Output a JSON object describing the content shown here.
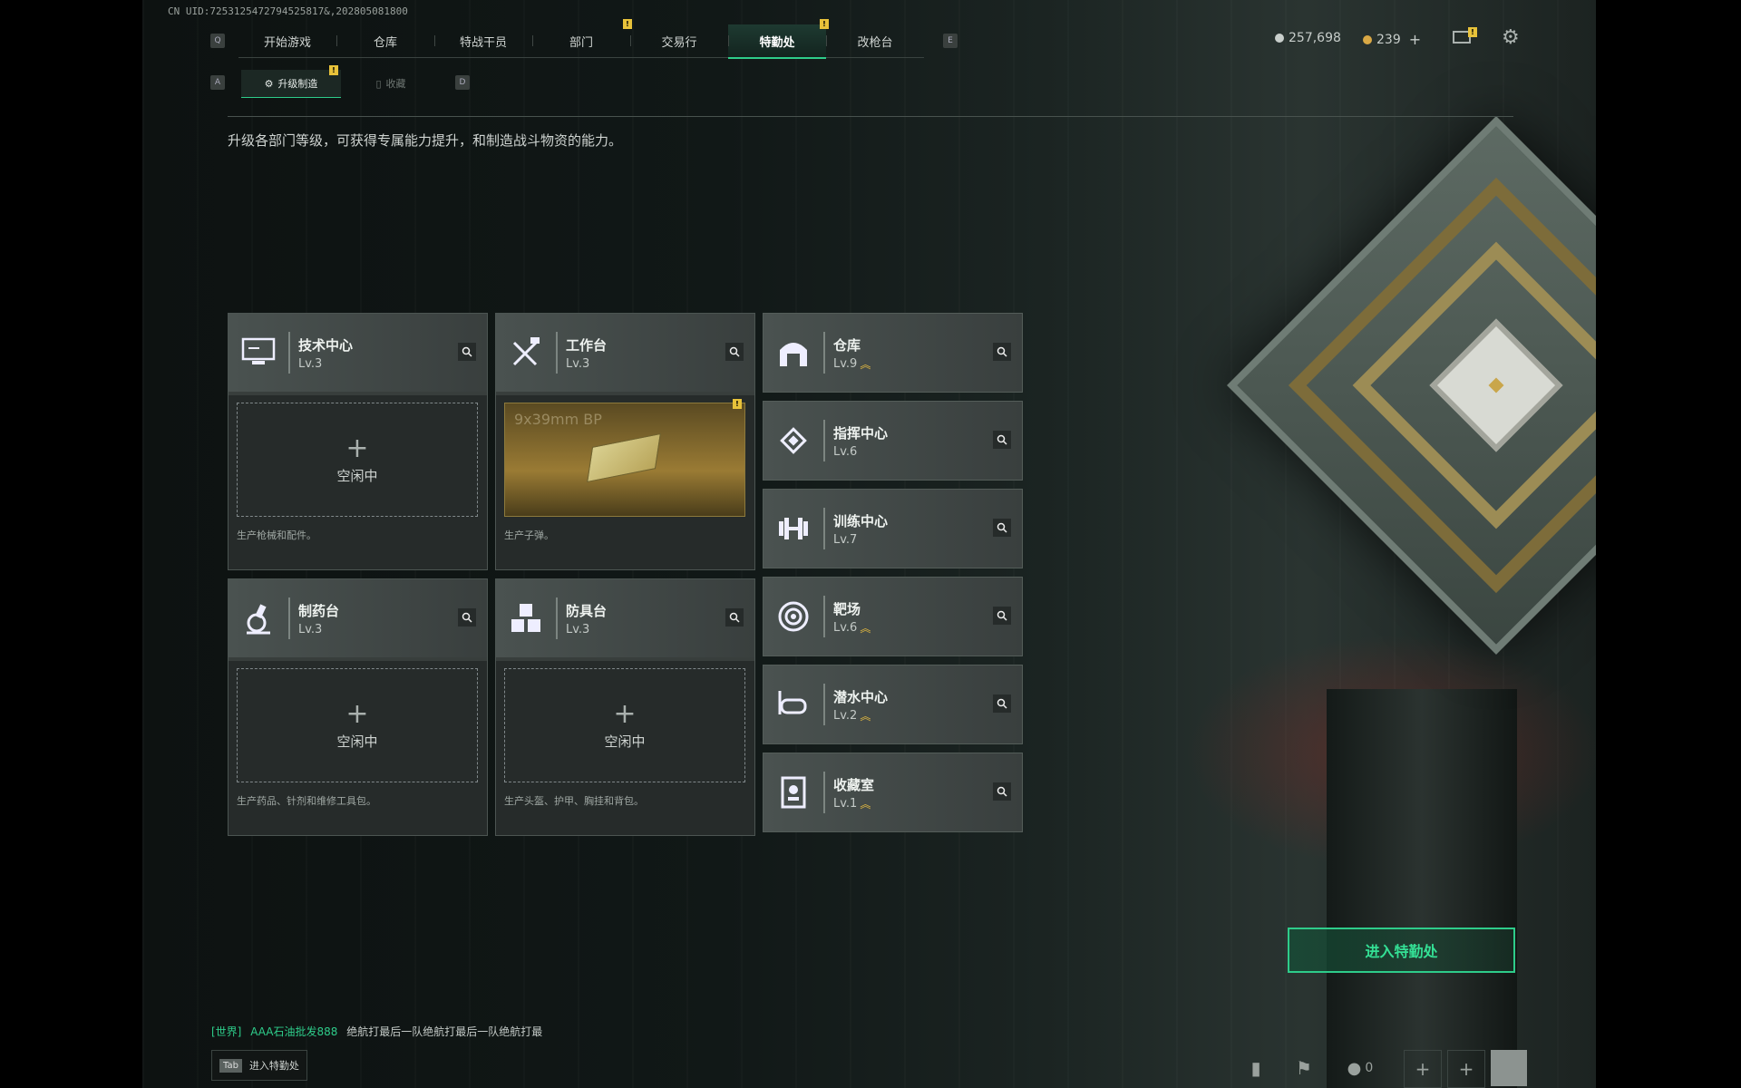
{
  "uid": "CN UID:7253125472794525817&,202805081800",
  "nav": {
    "left_key": "Q",
    "right_key": "E",
    "tabs": [
      "开始游戏",
      "仓库",
      "特战干员",
      "部门",
      "交易行",
      "特勤处",
      "改枪台"
    ],
    "active": "特勤处",
    "alert_mark": "!"
  },
  "subnav": {
    "left_key": "A",
    "right_key": "D",
    "tabs": [
      "升级制造",
      "收藏"
    ],
    "active": "升级制造"
  },
  "description": "升级各部门等级，可获得专属能力提升，和制造战斗物资的能力。",
  "currency": {
    "silver": "257,698",
    "gold": "239",
    "plus": "+"
  },
  "workstations": [
    {
      "name": "技术中心",
      "level": "Lv.3",
      "icon": "monitor-icon",
      "state": "空闲中",
      "desc": "生产枪械和配件。"
    },
    {
      "name": "工作台",
      "level": "Lv.3",
      "icon": "tools-icon",
      "item": "9x39mm BP",
      "desc": "生产子弹。"
    },
    {
      "name": "制药台",
      "level": "Lv.3",
      "icon": "microscope-icon",
      "state": "空闲中",
      "desc": "生产药品、针剂和维修工具包。"
    },
    {
      "name": "防具台",
      "level": "Lv.3",
      "icon": "cubes-icon",
      "state": "空闲中",
      "desc": "生产头盔、护甲、胸挂和背包。"
    }
  ],
  "facilities": [
    {
      "name": "仓库",
      "level": "Lv.9",
      "icon": "warehouse-icon",
      "upgrade": true
    },
    {
      "name": "指挥中心",
      "level": "Lv.6",
      "icon": "chip-icon",
      "upgrade": false
    },
    {
      "name": "训练中心",
      "level": "Lv.7",
      "icon": "dumbbell-icon",
      "upgrade": false
    },
    {
      "name": "靶场",
      "level": "Lv.6",
      "icon": "target-icon",
      "upgrade": true
    },
    {
      "name": "潜水中心",
      "level": "Lv.2",
      "icon": "diving-mask-icon",
      "upgrade": true
    },
    {
      "name": "收藏室",
      "level": "Lv.1",
      "icon": "display-case-icon",
      "upgrade": true
    }
  ],
  "enter_button": "进入特勤处",
  "chat": {
    "channel": "[世界]",
    "user": "AAA石油批发888",
    "message": "绝航打最后一队绝航打最后一队绝航打最"
  },
  "tab_hint": {
    "key": "Tab",
    "label": "进入特勤处"
  },
  "friends_count": "0",
  "colors": {
    "accent": "#2ecc8a",
    "alert": "#e8c23a",
    "upgrade": "#e3b940"
  }
}
